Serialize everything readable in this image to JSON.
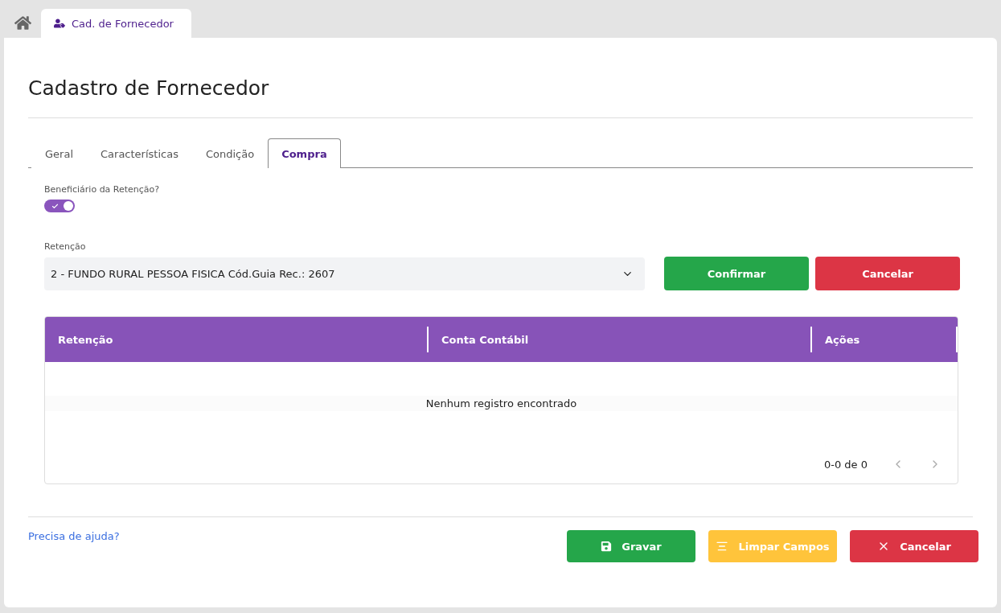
{
  "nav_tabs": [
    {
      "label": "Cad. de Fornecedor",
      "selected": true
    }
  ],
  "title": "Cadastro de Fornecedor",
  "tabs": [
    {
      "label": "Geral",
      "selected": false
    },
    {
      "label": "Características",
      "selected": false
    },
    {
      "label": "Condição",
      "selected": false
    },
    {
      "label": "Compra",
      "selected": true
    }
  ],
  "toggle": {
    "label": "Beneficiário da Retenção?",
    "on": true
  },
  "retention_select": {
    "label": "Retenção",
    "value": "2 - FUNDO RURAL PESSOA FISICA Cód.Guia Rec.: 2607"
  },
  "form_buttons": [
    {
      "label": "Confirmar",
      "kind": "success"
    },
    {
      "label": "Cancelar",
      "kind": "danger"
    }
  ],
  "table": {
    "columns": [
      "Retenção",
      "Conta Contábil",
      "Ações"
    ],
    "empty_message": "Nenhum registro encontrado",
    "pagination": "0-0 de 0"
  },
  "help_link": "Precisa de ajuda?",
  "footer_buttons": [
    {
      "label": "Gravar",
      "kind": "save"
    },
    {
      "label": "Limpar Campos",
      "kind": "clear"
    },
    {
      "label": "Cancelar",
      "kind": "cancel"
    }
  ]
}
